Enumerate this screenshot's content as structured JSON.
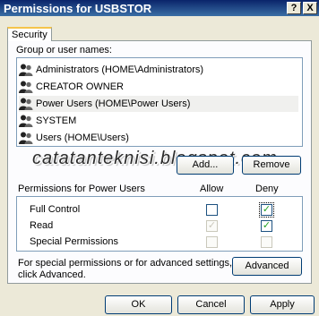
{
  "window": {
    "title": "Permissions for USBSTOR",
    "help_glyph": "?",
    "close_glyph": "X"
  },
  "tab": {
    "label": "Security"
  },
  "groups": {
    "label": "Group or user names:",
    "items": [
      {
        "label": "Administrators (HOME\\Administrators)",
        "icon": "users-group-icon"
      },
      {
        "label": "CREATOR OWNER",
        "icon": "users-group-icon"
      },
      {
        "label": "Power Users (HOME\\Power Users)",
        "icon": "users-group-icon",
        "selected": true
      },
      {
        "label": "SYSTEM",
        "icon": "users-group-icon"
      },
      {
        "label": "Users (HOME\\Users)",
        "icon": "users-group-icon"
      }
    ]
  },
  "watermark": "catatanteknisi.blogspot.com",
  "buttons": {
    "add": "Add...",
    "remove": "Remove",
    "advanced": "Advanced",
    "ok": "OK",
    "cancel": "Cancel",
    "apply": "Apply"
  },
  "permissions": {
    "header": "Permissions for Power Users",
    "allow_header": "Allow",
    "deny_header": "Deny",
    "rows": [
      {
        "label": "Full Control",
        "allow": false,
        "allow_disabled": false,
        "deny": true,
        "deny_disabled": false
      },
      {
        "label": "Read",
        "allow": true,
        "allow_disabled": true,
        "deny": true,
        "deny_disabled": false
      },
      {
        "label": "Special Permissions",
        "allow": false,
        "allow_disabled": true,
        "deny": false,
        "deny_disabled": true
      }
    ]
  },
  "advanced_text": "For special permissions or for advanced settings, click Advanced.",
  "colors": {
    "titlebar": "#0a246a",
    "dialog_bg": "#ece9d8",
    "check": "#21a121"
  }
}
